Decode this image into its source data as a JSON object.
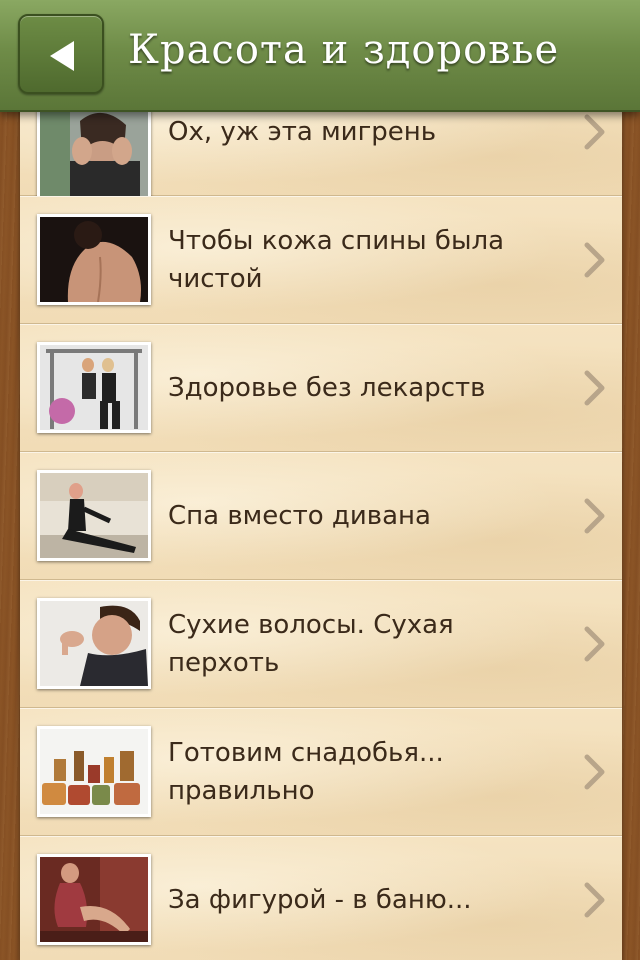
{
  "header": {
    "title": "Красота и здоровье",
    "back_icon": "back-arrow-icon",
    "colors": {
      "bar": "#6f8c48",
      "button": "#5a7636",
      "title": "#ffffff"
    }
  },
  "articles": [
    {
      "title": "Ох, уж эта мигрень",
      "thumb": "woman-headache-photo"
    },
    {
      "title": "Чтобы кожа спины была чистой",
      "thumb": "bare-back-photo"
    },
    {
      "title": "Здоровье без лекарств",
      "thumb": "gym-equipment-photo"
    },
    {
      "title": "Спа вместо дивана",
      "thumb": "woman-stretching-photo"
    },
    {
      "title": "Сухие волосы. Сухая перхоть",
      "thumb": "man-dandruff-photo"
    },
    {
      "title": "Готовим снадобья... правильно",
      "thumb": "herbal-jars-photo"
    },
    {
      "title": "За фигурой - в баню...",
      "thumb": "woman-sauna-photo"
    }
  ],
  "theme": {
    "row_bg": "#f3dfba",
    "text": "#3b2a1a",
    "chevron": "#b8a58a"
  }
}
